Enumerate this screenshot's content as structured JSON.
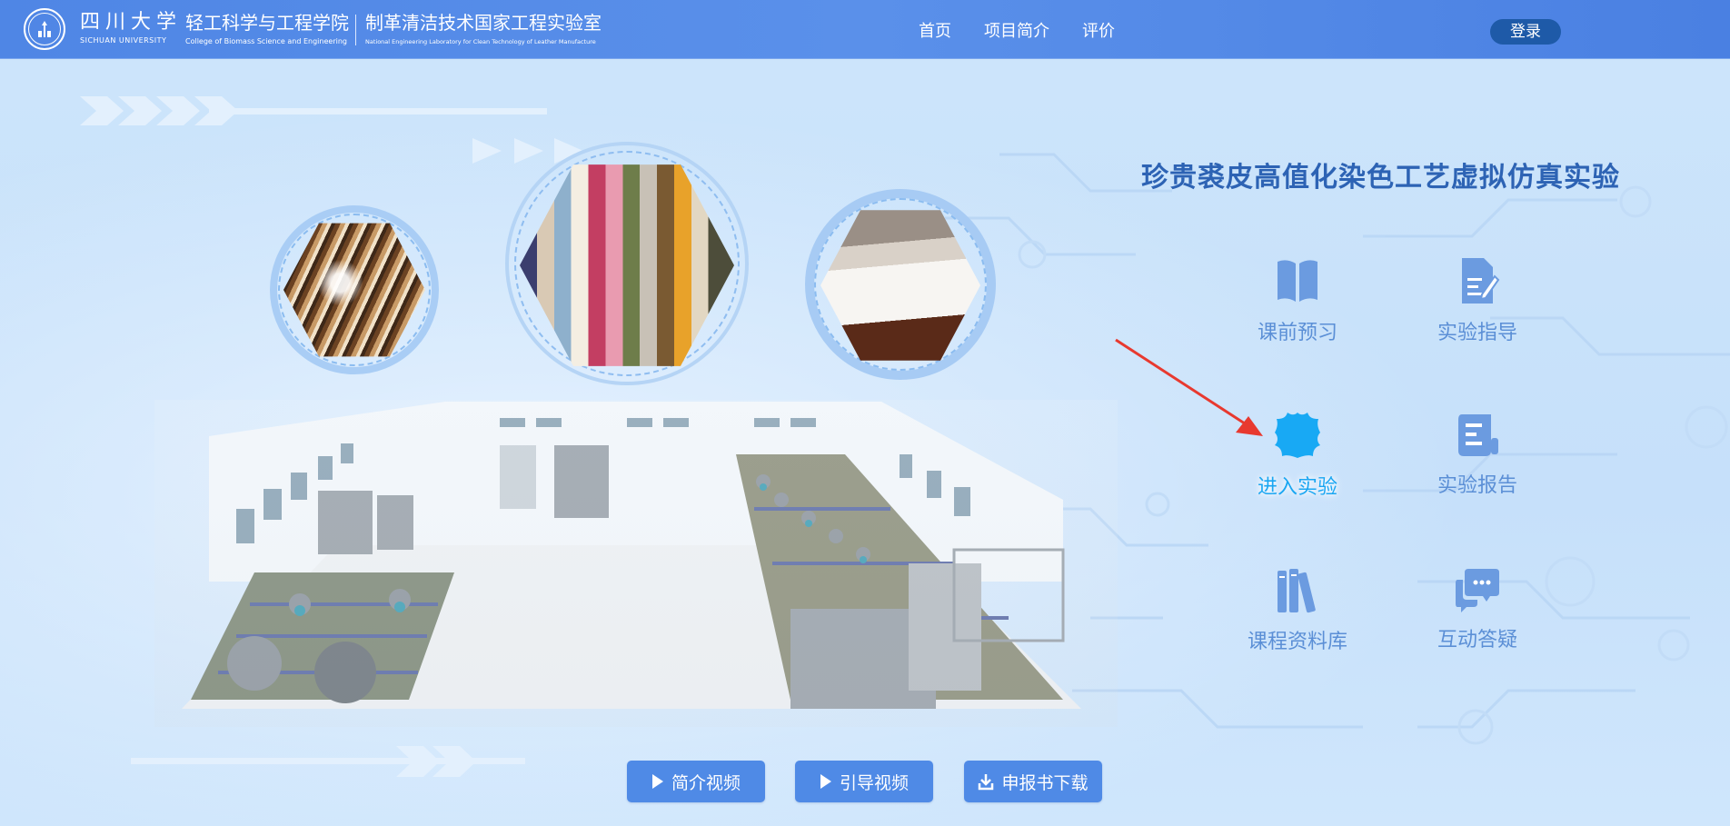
{
  "header": {
    "university_cn": "四川大学",
    "university_en": "SICHUAN UNIVERSITY",
    "college_cn": "轻工科学与工程学院",
    "college_en": "College of Biomass Science and Engineering",
    "lab_cn": "制革清洁技术国家工程实验室",
    "lab_en": "National Engineering Laboratory for Clean Technology of Leather Manufacture",
    "nav": [
      "首页",
      "项目简介",
      "评价"
    ],
    "login_label": "登录"
  },
  "main": {
    "title": "珍贵裘皮高值化染色工艺虚拟仿真实验",
    "menu": [
      {
        "label": "课前预习",
        "icon": "open-book-icon"
      },
      {
        "label": "实验指导",
        "icon": "document-edit-icon"
      },
      {
        "label": "进入实验",
        "icon": "leather-hide-icon",
        "active": true
      },
      {
        "label": "实验报告",
        "icon": "report-scroll-icon"
      },
      {
        "label": "课程资料库",
        "icon": "books-library-icon"
      },
      {
        "label": "互动答疑",
        "icon": "chat-bubbles-icon"
      }
    ]
  },
  "buttons": [
    {
      "label": "简介视频",
      "icon": "play-icon"
    },
    {
      "label": "引导视频",
      "icon": "play-icon"
    },
    {
      "label": "申报书下载",
      "icon": "download-icon"
    }
  ],
  "colors": {
    "header_bg": "#4f86e5",
    "title": "#2d63b4",
    "menu_label": "#5b8fd6",
    "menu_icon": "#6b9be0",
    "active": "#1aa6f2",
    "button_bg": "#4f8ae6",
    "login_bg": "#1e5aa8",
    "arrow": "#e8392f"
  }
}
